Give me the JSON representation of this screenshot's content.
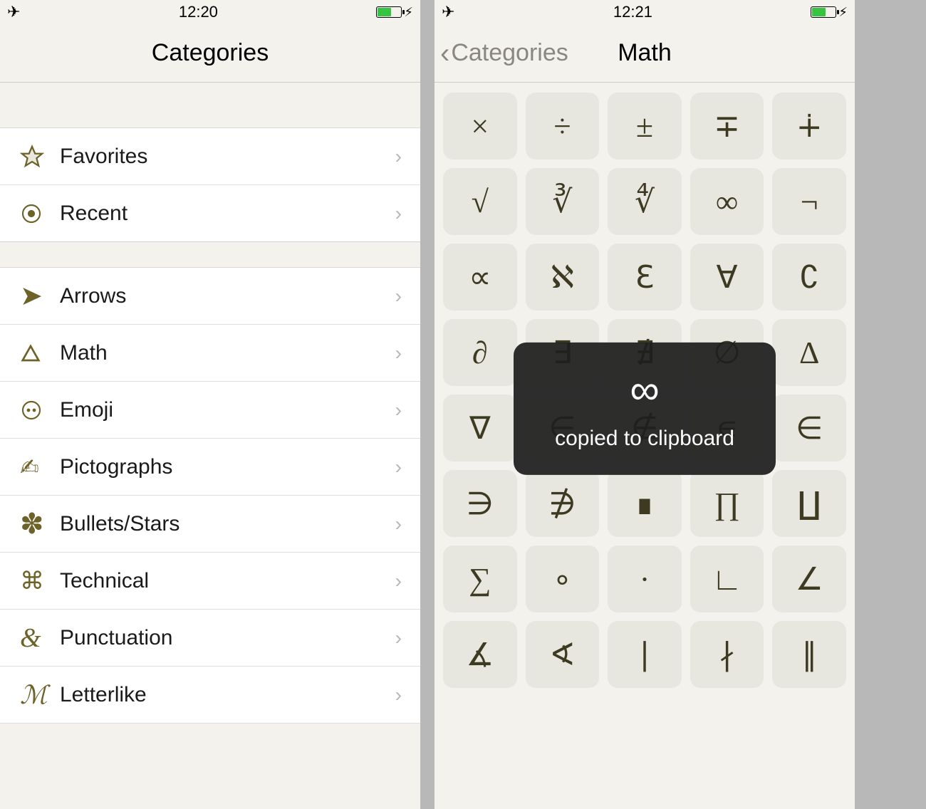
{
  "left": {
    "status_time": "12:20",
    "header_title": "Categories",
    "section1": [
      {
        "icon": "star",
        "label": "Favorites"
      },
      {
        "icon": "target",
        "label": "Recent"
      }
    ],
    "section2": [
      {
        "icon": "arrow",
        "label": "Arrows"
      },
      {
        "icon": "triangle",
        "label": "Math"
      },
      {
        "icon": "face",
        "label": "Emoji"
      },
      {
        "icon": "hand",
        "label": "Pictographs"
      },
      {
        "icon": "asterisk",
        "label": "Bullets/Stars"
      },
      {
        "icon": "command",
        "label": "Technical"
      },
      {
        "icon": "ampersand",
        "label": "Punctuation"
      },
      {
        "icon": "script-m",
        "label": "Letterlike"
      }
    ]
  },
  "right": {
    "status_time": "12:21",
    "back_label": "Categories",
    "header_title": "Math",
    "toast_glyph": "∞",
    "toast_message": "copied to clipboard",
    "symbols": [
      "×",
      "÷",
      "±",
      "∓",
      "∔",
      "√",
      "∛",
      "∜",
      "∞",
      "¬",
      "∝",
      "ℵ",
      "ℇ",
      "∀",
      "∁",
      "∂",
      "∃",
      "∄",
      "∅",
      "∆",
      "∇",
      "∈",
      "∉",
      "∊",
      "∈",
      "∋",
      "∌",
      "∎",
      "∏",
      "∐",
      "∑",
      "∘",
      "∙",
      "∟",
      "∠",
      "∡",
      "∢",
      "∣",
      "∤",
      "∥"
    ]
  }
}
